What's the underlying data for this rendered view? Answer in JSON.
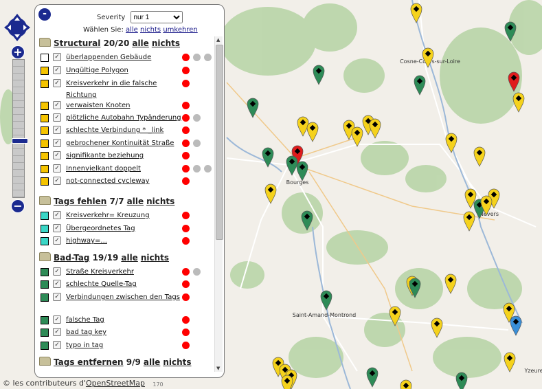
{
  "map": {
    "places": [
      "Cosne-Cours-sur-Loire",
      "Bourges",
      "Nevers",
      "Saint-Amand-Montrond",
      "Yzeure"
    ],
    "scale_fragment": "170",
    "attribution_prefix": "© les contributeurs d'",
    "attribution_link": "OpenStreetMap"
  },
  "controls": {
    "zoom_in": "+",
    "zoom_out": "−",
    "collapse": "-"
  },
  "panel": {
    "severity_label": "Severity",
    "severity_value": "nur 1",
    "select_label": "Wählen Sie:",
    "select_all": "alle",
    "select_none": "nichts",
    "select_invert": "umkehren",
    "groups": [
      {
        "title": "Structural",
        "count": "20/20",
        "all": "alle",
        "none": "nichts"
      },
      {
        "title": "Tags fehlen",
        "count": "7/7",
        "all": "alle",
        "none": "nichts"
      },
      {
        "title": "Bad-Tag",
        "count": "19/19",
        "all": "alle",
        "none": "nichts"
      },
      {
        "title": "Tags entfernen",
        "count": "9/9",
        "all": "alle",
        "none": "nichts"
      }
    ],
    "items": [
      {
        "label": "überlappenden Gebäude",
        "icon_color": "#000000",
        "icon_bg": "#ffffff",
        "levels": [
          "red",
          "grey",
          "grey"
        ]
      },
      {
        "label": "Ungültige Polygon",
        "icon_color": "#000000",
        "icon_bg": "#f5c400",
        "levels": [
          "red"
        ]
      },
      {
        "label": "Kreisverkehr in die falsche Richtung",
        "icon_color": "#000000",
        "icon_bg": "#f5c400",
        "levels": [
          "red"
        ]
      },
      {
        "label": "verwaisten Knoten",
        "icon_color": "#000000",
        "icon_bg": "#f5c400",
        "levels": [
          "red"
        ]
      },
      {
        "label": "plötzliche Autobahn Typänderung",
        "icon_color": "#000000",
        "icon_bg": "#f5c400",
        "levels": [
          "red",
          "grey"
        ]
      },
      {
        "label": "schlechte Verbindung * _link",
        "icon_color": "#000000",
        "icon_bg": "#f5c400",
        "levels": [
          "red"
        ]
      },
      {
        "label": "gebrochener Kontinuität Straße",
        "icon_color": "#000000",
        "icon_bg": "#f5c400",
        "levels": [
          "red",
          "grey"
        ]
      },
      {
        "label": "signifikante beziehung",
        "icon_color": "#000000",
        "icon_bg": "#f5c400",
        "levels": [
          "red"
        ]
      },
      {
        "label": "Innenvielkant doppelt",
        "icon_color": "#000000",
        "icon_bg": "#f5c400",
        "levels": [
          "red",
          "grey",
          "grey"
        ]
      },
      {
        "label": "not-connected cycleway",
        "icon_color": "#000000",
        "icon_bg": "#f5c400",
        "levels": [
          "red"
        ]
      },
      {
        "label": "Kreisverkehr= Kreuzung",
        "icon_color": "#000000",
        "icon_bg": "#3ad6c6",
        "levels": [
          "red"
        ]
      },
      {
        "label": "Übergeordnetes Tag",
        "icon_color": "#000000",
        "icon_bg": "#3ad6c6",
        "levels": [
          "red"
        ]
      },
      {
        "label": "highway=...",
        "icon_color": "#000000",
        "icon_bg": "#3ad6c6",
        "levels": [
          "red"
        ]
      },
      {
        "label": "Straße Kreisverkehr",
        "icon_color": "#000000",
        "icon_bg": "#2e8b57",
        "levels": [
          "red",
          "grey"
        ]
      },
      {
        "label": "schlechte Quelle-Tag",
        "icon_color": "#000000",
        "icon_bg": "#2e8b57",
        "levels": [
          "red"
        ]
      },
      {
        "label": "Verbindungen zwischen den Tags",
        "icon_color": "#000000",
        "icon_bg": "#2e8b57",
        "levels": [
          "red"
        ]
      },
      {
        "label": "falsche Tag",
        "icon_color": "#000000",
        "icon_bg": "#2e8b57",
        "levels": [
          "red"
        ]
      },
      {
        "label": "bad tag key",
        "icon_color": "#000000",
        "icon_bg": "#2e8b57",
        "levels": [
          "red"
        ]
      },
      {
        "label": "typo in tag",
        "icon_color": "#000000",
        "icon_bg": "#2e8b57",
        "levels": [
          "red"
        ]
      }
    ]
  },
  "colors": {
    "map_bg": "#f2efe9",
    "forest": "#b9d5a8",
    "river": "#9cb8d8",
    "pin_yellow": "#f5d21c",
    "pin_green": "#2e8b57",
    "pin_red": "#e01c1c",
    "pin_blue": "#3a8fd8",
    "dot_red": "#ff0000",
    "dot_grey": "#bbbbbb"
  }
}
